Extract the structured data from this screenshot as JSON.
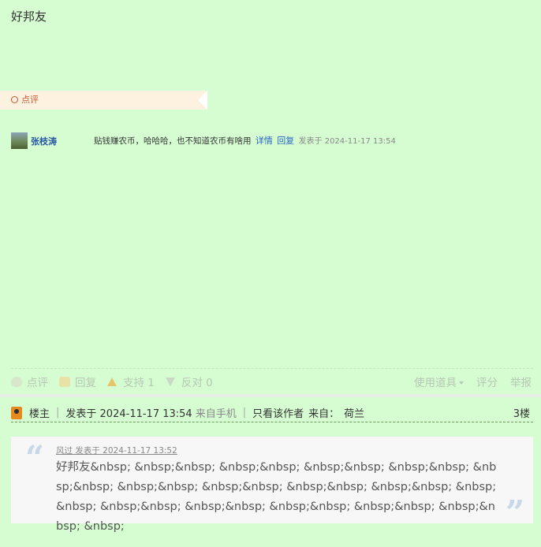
{
  "post": {
    "text": "好邦友"
  },
  "comment_section": {
    "label": "点评"
  },
  "comment": {
    "author": "张枝涛",
    "text": "贴钱赚农币，哈哈哈，也不知道农币有啥用",
    "detail_link": "详情",
    "reply_link": "回复",
    "meta": "发表于 2024-11-17 13:54"
  },
  "actions": {
    "comment": "点评",
    "reply": "回复",
    "support": "支持 1",
    "oppose": "反对 0",
    "tools": "使用道具",
    "rate": "评分",
    "report": "举报"
  },
  "floor": {
    "role": "楼主",
    "posted": "发表于 2024-11-17 13:54",
    "from_mobile": "来自手机",
    "only_author": "只看该作者",
    "origin_label": "来自：",
    "origin": "荷兰",
    "number": "3楼"
  },
  "quote": {
    "header": "风过 发表于 2024-11-17 13:52",
    "body": "好邦友&nbsp; &nbsp;&nbsp; &nbsp;&nbsp; &nbsp;&nbsp; &nbsp;&nbsp; &nbsp;&nbsp; &nbsp;&nbsp; &nbsp;&nbsp; &nbsp;&nbsp; &nbsp;&nbsp; &nbsp;&nbsp; &nbsp;&nbsp; &nbsp;&nbsp; &nbsp;&nbsp; &nbsp;&nbsp; &nbsp;&nbsp; &nbsp;"
  },
  "icons": {
    "comment": "comment-icon",
    "reply": "reply-icon",
    "support": "thumb-up-icon",
    "oppose": "thumb-down-icon",
    "floor": "user-badge-icon"
  },
  "colors": {
    "background": "#d5fdd1",
    "link": "#2a66c4",
    "accent": "#c45a33"
  }
}
